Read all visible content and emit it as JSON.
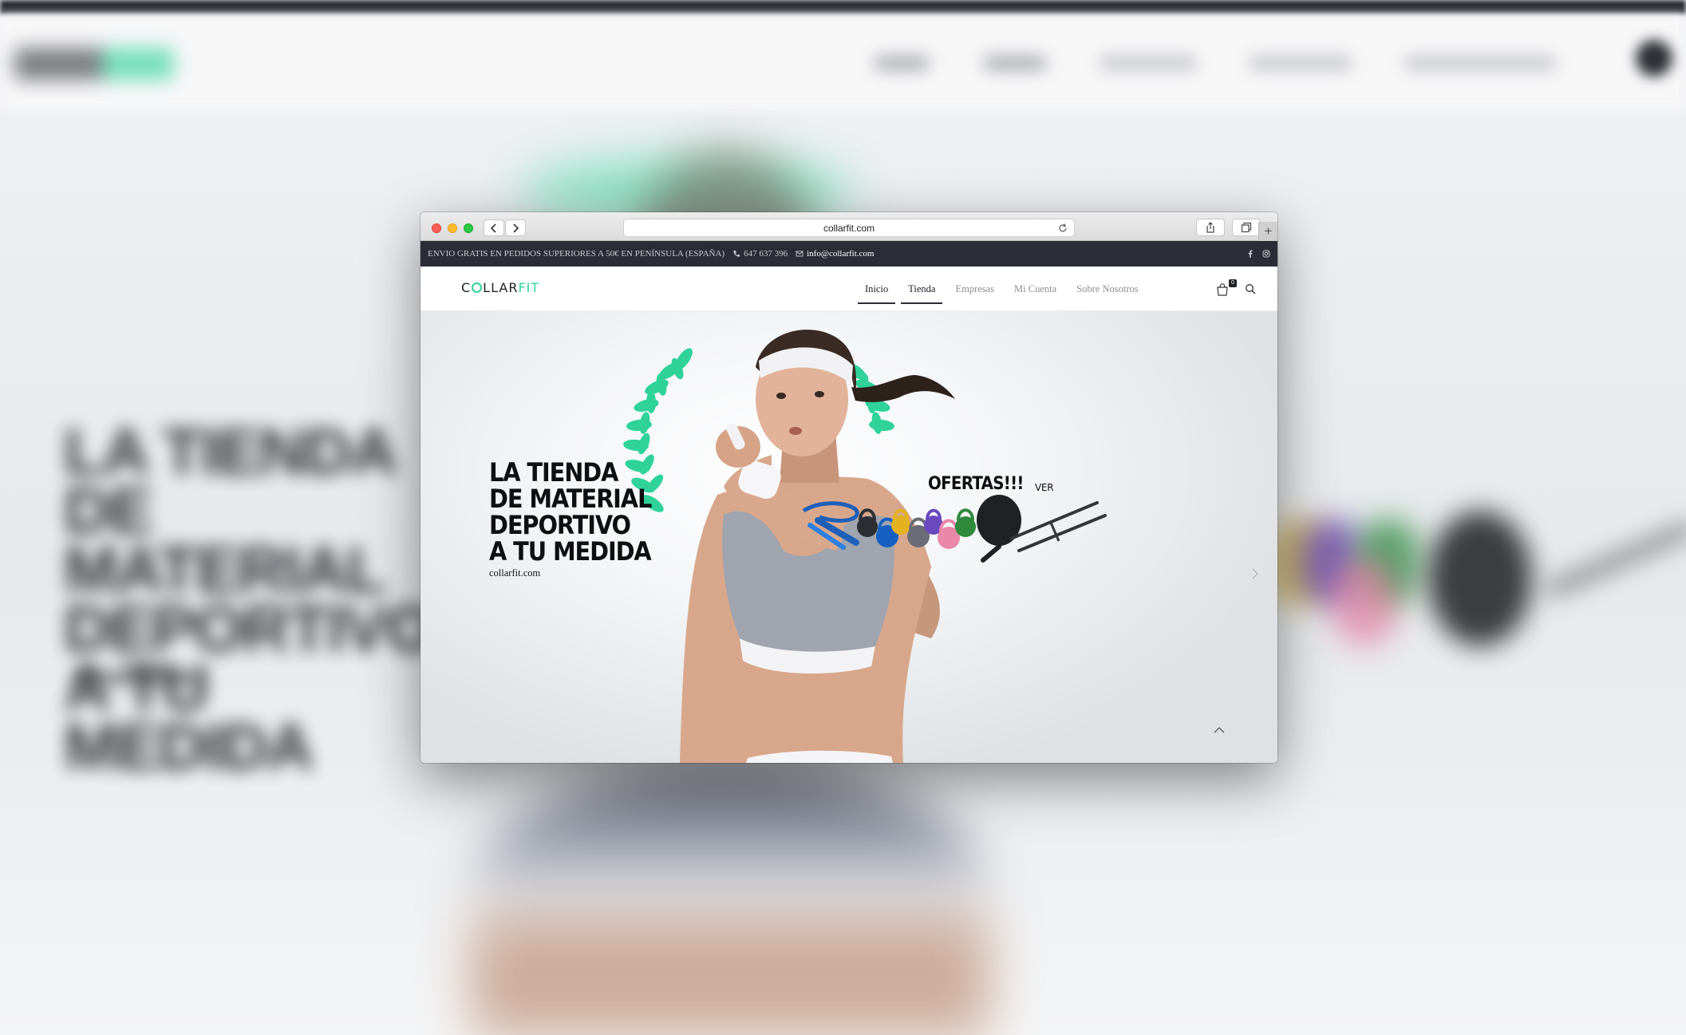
{
  "browser": {
    "url": "collarfit.com"
  },
  "topbar": {
    "shipping_note": "ENVIO GRATIS EN PEDIDOS SUPERIORES A 50€ EN PENÍNSULA (ESPAÑA)",
    "phone": "647 637 396",
    "email": "info@collarfit.com",
    "social": [
      "facebook-icon",
      "instagram-icon"
    ]
  },
  "header": {
    "logo_left": "C",
    "logo_mid": "LLAR",
    "logo_right": "FIT",
    "nav": [
      {
        "label": "Inicio",
        "active": true
      },
      {
        "label": "Tienda",
        "active": true
      },
      {
        "label": "Empresas",
        "active": false
      },
      {
        "label": "Mi Cuenta",
        "active": false
      },
      {
        "label": "Sobre Nosotros",
        "active": false
      }
    ],
    "cart_count": "0"
  },
  "hero": {
    "headline": [
      "LA TIENDA",
      "DE MATERIAL",
      "DEPORTIVO",
      "A TU MEDIDA"
    ],
    "site_url": "collarfit.com",
    "offers_label": "OFERTAS!!!",
    "offers_link": "VER"
  },
  "backdrop": {
    "headline": [
      "LA TIENDA",
      "DE MATERIAL",
      "DEPORTIVO",
      "A TU MEDIDA"
    ]
  },
  "colors": {
    "brand_green": "#2fd39a",
    "dark": "#2b2d36",
    "text_dark": "#1f2126"
  }
}
